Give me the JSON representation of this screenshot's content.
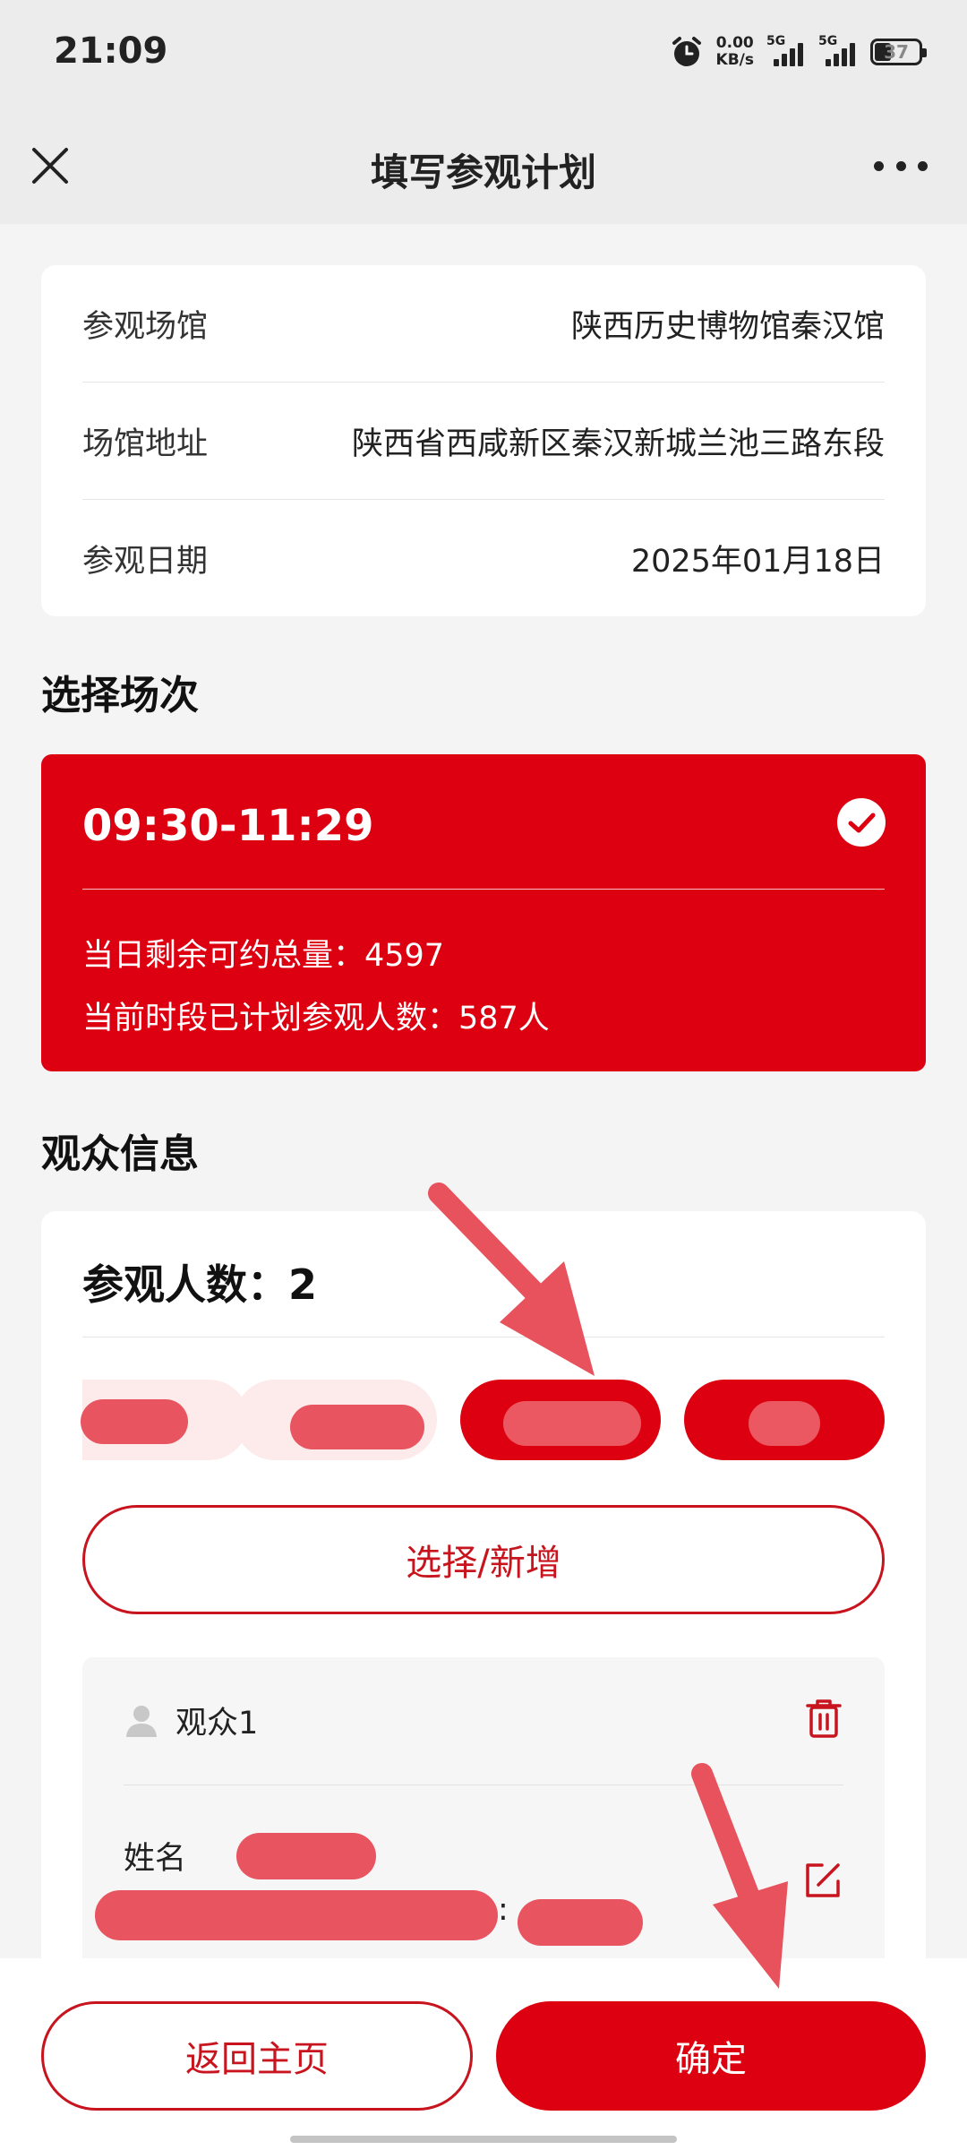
{
  "status_bar": {
    "time": "21:09",
    "net_speed_value": "0.00",
    "net_speed_unit": "KB/s",
    "signal1": "5G",
    "signal2": "5G",
    "battery": "37"
  },
  "header": {
    "title": "填写参观计划"
  },
  "info": {
    "rows": [
      {
        "label": "参观场馆",
        "value": "陕西历史博物馆秦汉馆"
      },
      {
        "label": "场馆地址",
        "value": "陕西省西咸新区秦汉新城兰池三路东段"
      },
      {
        "label": "参观日期",
        "value": "2025年01月18日"
      }
    ]
  },
  "session_section": {
    "title": "选择场次",
    "time_slot": "09:30-11:29",
    "remaining": "当日剩余可约总量：4597",
    "planned": "当前时段已计划参观人数：587人"
  },
  "visitor_section": {
    "title": "观众信息",
    "count_label": "参观人数：2",
    "select_button": "选择/新增",
    "viewer_label": "观众1",
    "name_label": "姓名",
    "colon": ":"
  },
  "bottom": {
    "back_button": "返回主页",
    "confirm_button": "确定"
  },
  "colors": {
    "brand_red": "#dd0010",
    "outline_red": "#c8141e",
    "redaction": "#e85560"
  }
}
